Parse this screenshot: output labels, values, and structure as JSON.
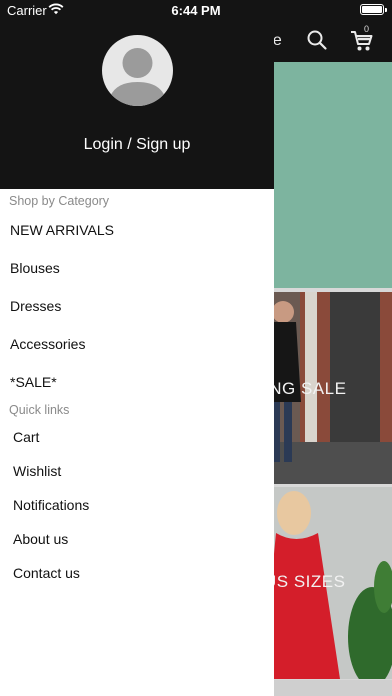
{
  "status_bar": {
    "carrier": "Carrier",
    "time": "6:44 PM"
  },
  "app": {
    "title_fragment": "pe",
    "cart_count": "0",
    "banners": {
      "spring": "ING SALE",
      "plus": "US SIZES"
    }
  },
  "drawer": {
    "login_label": "Login / Sign up",
    "shop_by_category_label": "Shop by Category",
    "categories": [
      "NEW ARRIVALS",
      "Blouses",
      "Dresses",
      "Accessories",
      "*SALE*"
    ],
    "quick_links_label": "Quick links",
    "quick_links": [
      "Cart",
      "Wishlist",
      "Notifications",
      "About us",
      "Contact us"
    ]
  },
  "colors": {
    "header_bg": "#141414",
    "hero_bg": "#7db49f",
    "drawer_bg": "#ffffff"
  }
}
